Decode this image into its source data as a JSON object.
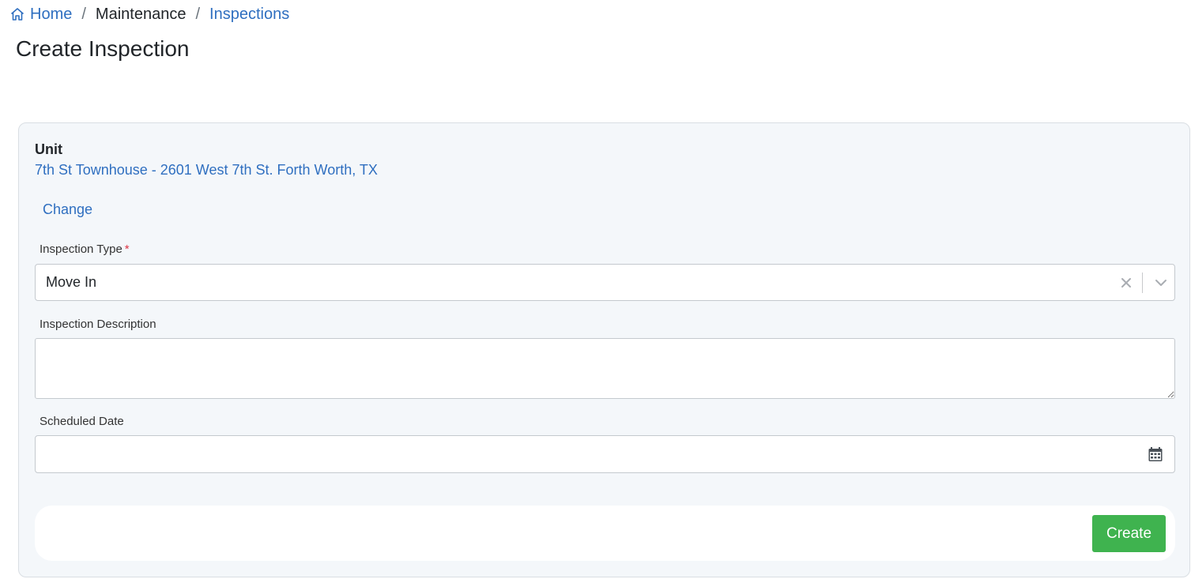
{
  "breadcrumb": {
    "home_label": "Home",
    "separator": "/",
    "maintenance_label": "Maintenance",
    "inspections_label": "Inspections",
    "home_icon": "home-icon"
  },
  "page": {
    "title": "Create Inspection"
  },
  "unit": {
    "heading": "Unit",
    "address": "7th St Townhouse - 2601 West 7th St. Forth Worth, TX",
    "change_label": "Change"
  },
  "form": {
    "inspection_type": {
      "label": "Inspection Type",
      "required_marker": "*",
      "value": "Move In",
      "clear_icon": "close-icon",
      "dropdown_icon": "chevron-down-icon"
    },
    "inspection_description": {
      "label": "Inspection Description",
      "value": ""
    },
    "scheduled_date": {
      "label": "Scheduled Date",
      "value": "",
      "icon": "calendar-icon"
    }
  },
  "actions": {
    "create_label": "Create"
  },
  "colors": {
    "link": "#2f6fc0",
    "card_background": "#f4f7fa",
    "primary_button": "#3fb34f",
    "required": "#dc3545"
  }
}
